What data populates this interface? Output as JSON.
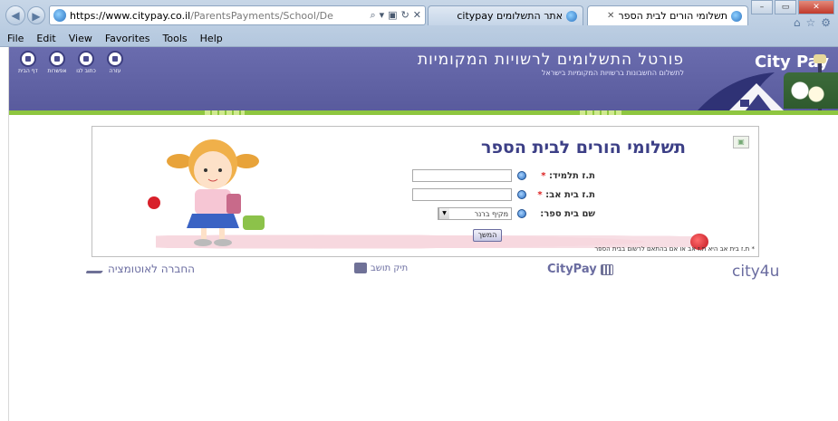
{
  "browser": {
    "url_host": "https://www.citypay.co.il",
    "url_rest": "/ParentsPayments/School/De",
    "tabs": [
      {
        "title": "אתר התשלומים citypay"
      },
      {
        "title": "תשלומי הורים לבית הספר"
      }
    ],
    "menu": [
      "File",
      "Edit",
      "View",
      "Favorites",
      "Tools",
      "Help"
    ]
  },
  "header": {
    "brand": "City Pay",
    "portal_title": "פורטל התשלומים לרשויות המקומיות",
    "portal_subtitle": "לתשלום החשבונות ברשויות המקומיות בישראל",
    "icons": [
      {
        "icon": "home-icon",
        "label": "דף הבית"
      },
      {
        "icon": "help-icon",
        "label": "אפשרות"
      },
      {
        "icon": "mail-icon",
        "label": "כתוב לנו"
      },
      {
        "icon": "list-icon",
        "label": "עזרה"
      }
    ]
  },
  "form": {
    "title": "תשלומי הורים לבית הספר",
    "fields": [
      {
        "label": "ת.ז תלמיד:",
        "required": "*",
        "value": ""
      },
      {
        "label": "ת.ז בית אב:",
        "required": "*",
        "value": ""
      },
      {
        "label": "שם בית ספר:",
        "required": "",
        "value": "מקיף ברנר"
      }
    ],
    "continue_label": "המשך",
    "footnote": "* ת.ז בית אב היא ת.ז אב או אם בהתאם לרשום בבית הספר"
  },
  "footer": {
    "company": "החברה לאוטומציה",
    "resident_file": "תיק תושב",
    "citypay": "CityPay",
    "city4u": "city4u"
  },
  "colors": {
    "header_bg": "#5f61a3",
    "accent_green": "#8ec640",
    "title_color": "#3c3f86"
  }
}
